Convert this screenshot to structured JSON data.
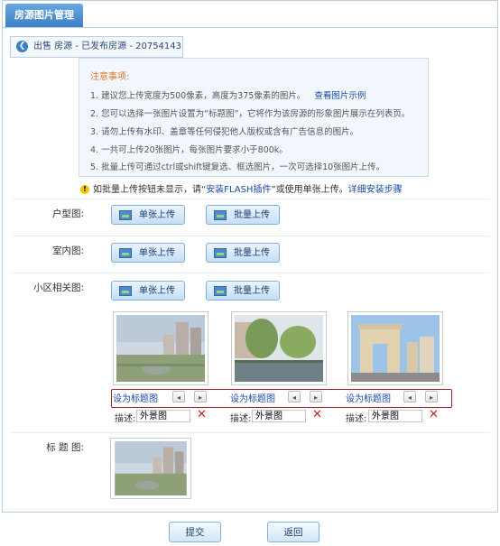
{
  "tab": {
    "title": "房源图片管理"
  },
  "breadcrumb": {
    "text": "出售 房源 - 已发布房源 - 20754143"
  },
  "notice": {
    "title": "注意事项:",
    "lines": [
      "1. 建议您上传宽度为500像素，高度为375像素的图片。",
      "2. 您可以选择一张图片设置为“标题图”，它将作为该房源的形象图片展示在列表页。",
      "3. 请勿上传有水印、盖章等任何侵犯他人版权或含有广告信息的图片。",
      "4. 一共可上传20张图片，每张图片要求小于800k。",
      "5. 批量上传可通过ctrl或shift键复选、框选图片，一次可选择10张图片上传。"
    ],
    "example_link": "查看图片示例"
  },
  "warning": {
    "text1": "如批量上传按钮未显示，请“",
    "link1": "安装FLASH插件",
    "text2": "”或使用单张上传。",
    "link2": "详细安装步骤"
  },
  "rows": {
    "floorplan": {
      "label": "户型图:"
    },
    "interior": {
      "label": "室内图:"
    },
    "community": {
      "label": "小区相关图:"
    },
    "title_image": {
      "label": "标 题 图:"
    }
  },
  "buttons": {
    "single_upload": "单张上传",
    "batch_upload": "批量上传"
  },
  "photos": [
    {
      "set_title": "设为标题图",
      "desc_label": "描述:",
      "desc_value": "外景图"
    },
    {
      "set_title": "设为标题图",
      "desc_label": "描述:",
      "desc_value": "外景图"
    },
    {
      "set_title": "设为标题图",
      "desc_label": "描述:",
      "desc_value": "外景图"
    }
  ],
  "arrows": {
    "prev": "◂",
    "next": "▸"
  },
  "delete_symbol": "✕",
  "footer": {
    "submit": "提交",
    "back": "返回"
  }
}
